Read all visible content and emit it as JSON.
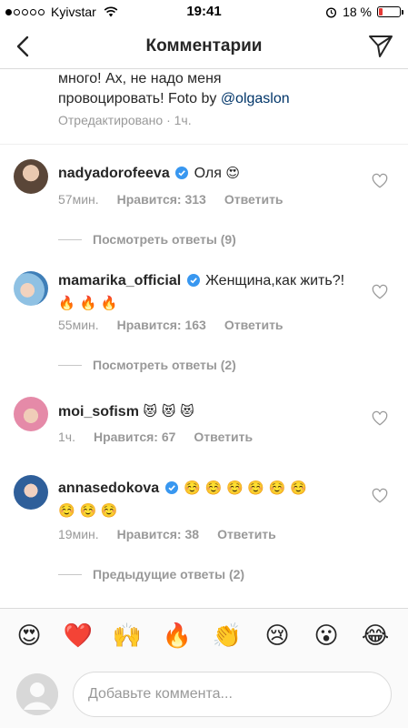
{
  "status": {
    "carrier": "Kyivstar",
    "time": "19:41",
    "battery": "18 %",
    "battery_level": 0.18,
    "signal_bars": 1,
    "icons": [
      "signal-dots-icon",
      "wifi-icon",
      "alarm-icon",
      "battery-icon"
    ]
  },
  "nav": {
    "title": "Комментарии",
    "back_icon": "chevron-left-icon",
    "send_icon": "paper-plane-icon"
  },
  "caption": {
    "line1": "много! Ах, не надо меня",
    "line2_prefix": "провоцировать! Foto by ",
    "mention": "@olgaslon",
    "meta": "Отредактировано · 1ч."
  },
  "comments": [
    {
      "username": "nadyadorofeeva",
      "verified": true,
      "text": "Оля",
      "emoji": "😍",
      "time": "57мин.",
      "likes": "Нравится: 313",
      "reply": "Ответить",
      "view_replies": "Посмотреть ответы (9)",
      "avatar_color": "#6b5a4e"
    },
    {
      "username": "mamarika_official",
      "verified": true,
      "text": "Женщина,как жить?!",
      "emoji": "🔥 🔥 🔥",
      "time": "55мин.",
      "likes": "Нравится: 163",
      "reply": "Ответить",
      "view_replies": "Посмотреть ответы (2)",
      "avatar_color": "#4a90c8"
    },
    {
      "username": "moi_sofism",
      "verified": false,
      "text": "",
      "emoji": "😻 😻 😻",
      "time": "1ч.",
      "likes": "Нравится: 67",
      "reply": "Ответить",
      "avatar_color": "#d98ba0"
    },
    {
      "username": "annasedokova",
      "verified": true,
      "text": "",
      "emoji": "☺️ ☺️ ☺️ ☺️ ☺️ ☺️",
      "emoji_line2": "☺️ ☺️ ☺️",
      "time": "19мин.",
      "likes": "Нравится: 38",
      "reply": "Ответить",
      "view_replies": "Предыдущие ответы (2)",
      "avatar_color": "#2b6aa8"
    }
  ],
  "emoji_bar": [
    "😍",
    "❤️",
    "🙌",
    "🔥",
    "👏",
    "😢",
    "😮",
    "😂"
  ],
  "input": {
    "placeholder": "Добавьте коммента..."
  },
  "colors": {
    "verified_blue": "#3897f0",
    "meta_gray": "#999999",
    "mention_blue": "#003569"
  }
}
